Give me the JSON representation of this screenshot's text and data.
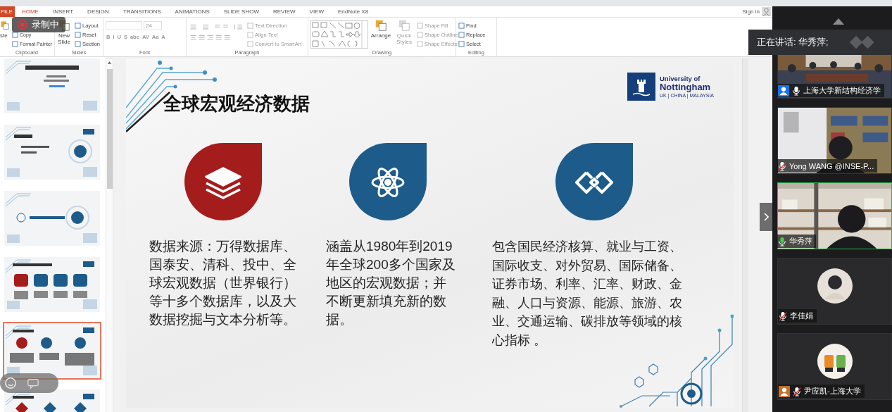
{
  "ribbon_tabs": [
    {
      "label": "FILE",
      "kind": "file",
      "selected": false
    },
    {
      "label": "HOME",
      "kind": "tab",
      "selected": true
    },
    {
      "label": "INSERT",
      "kind": "tab",
      "selected": false
    },
    {
      "label": "DESIGN",
      "kind": "tab",
      "selected": false
    },
    {
      "label": "TRANSITIONS",
      "kind": "tab",
      "selected": false
    },
    {
      "label": "ANIMATIONS",
      "kind": "tab",
      "selected": false
    },
    {
      "label": "SLIDE SHOW",
      "kind": "tab",
      "selected": false
    },
    {
      "label": "REVIEW",
      "kind": "tab",
      "selected": false
    },
    {
      "label": "VIEW",
      "kind": "tab",
      "selected": false
    },
    {
      "label": "EndNote X8",
      "kind": "tab",
      "selected": false
    }
  ],
  "account": {
    "label": "Sign in"
  },
  "ribbon_groups": [
    {
      "label": "Clipboard",
      "columns": [
        {
          "kind": "large",
          "items": [
            {
              "label": "ste",
              "disabled": false
            }
          ]
        },
        {
          "kind": "small",
          "items": [
            {
              "label": "Copy",
              "disabled": false
            },
            {
              "label": "Format Painter",
              "disabled": false
            }
          ]
        }
      ]
    },
    {
      "label": "Slides",
      "columns": [
        {
          "kind": "large",
          "items": [
            {
              "label": "New Slide",
              "disabled": false
            }
          ]
        },
        {
          "kind": "small",
          "items": [
            {
              "label": "Layout",
              "disabled": false
            },
            {
              "label": "Reset",
              "disabled": false
            },
            {
              "label": "Section",
              "disabled": false
            }
          ]
        }
      ]
    },
    {
      "label": "Font",
      "columns": [
        {
          "kind": "font",
          "size": "24",
          "buttons": [
            "B",
            "I",
            "U",
            "S",
            "abc",
            "AV",
            "Aa",
            "A"
          ]
        }
      ]
    },
    {
      "label": "Paragraph",
      "columns": [
        {
          "kind": "tools"
        },
        {
          "kind": "small",
          "items": [
            {
              "label": "Text Direction",
              "disabled": true
            },
            {
              "label": "Align Text",
              "disabled": true
            },
            {
              "label": "Convert to SmartArt",
              "disabled": true
            }
          ]
        }
      ]
    },
    {
      "label": "Drawing",
      "columns": [
        {
          "kind": "gallery"
        },
        {
          "kind": "large",
          "items": [
            {
              "label": "Arrange",
              "disabled": false
            }
          ]
        },
        {
          "kind": "large",
          "items": [
            {
              "label": "Quick Styles",
              "disabled": true
            }
          ]
        },
        {
          "kind": "small",
          "items": [
            {
              "label": "Shape Fill",
              "disabled": true
            },
            {
              "label": "Shape Outline",
              "disabled": true
            },
            {
              "label": "Shape Effects",
              "disabled": true
            }
          ]
        }
      ]
    },
    {
      "label": "Editing",
      "columns": [
        {
          "kind": "small",
          "items": [
            {
              "label": "Find",
              "disabled": false
            },
            {
              "label": "Replace",
              "disabled": false
            },
            {
              "label": "Select",
              "disabled": false
            }
          ]
        }
      ]
    }
  ],
  "recording": {
    "label": "录制中"
  },
  "slides": [
    {
      "kind": "title",
      "selected": false
    },
    {
      "kind": "agenda",
      "selected": false
    },
    {
      "kind": "section",
      "selected": false
    },
    {
      "kind": "cards",
      "selected": false
    },
    {
      "kind": "drops",
      "selected": true
    },
    {
      "kind": "diamonds",
      "selected": false
    }
  ],
  "slide": {
    "title": "全球宏观经济数据",
    "logo": {
      "line_1": "University of",
      "line_2": "Nottingham",
      "line_3": "UK | CHINA | MALAYSIA"
    },
    "columns": [
      {
        "color": "#a51c1c",
        "text": "数据来源：万得数据库、国泰安、清科、投中、全球宏观数据（世界银行）等十多个数据库，以及大数据挖掘与文本分析等。"
      },
      {
        "color": "#1d5b8a",
        "text": "涵盖从1980年到2019年全球200多个国家及地区的宏观数据；并不断更新填充新的数据。"
      },
      {
        "color": "#1d5b8a",
        "text": "包含国民经济核算、就业与工资、国际收支、对外贸易、国际储备、证券市场、利率、汇率、财政、金融、人口与资源、能源、旅游、农业、交通运输、碳排放等领域的核心指标 。"
      }
    ]
  },
  "speaking": {
    "label": "正在讲话: 华秀萍;"
  },
  "participants": [
    {
      "name": "上海大学新结构经济学",
      "kind": "video",
      "muted": false,
      "speaking": false,
      "badge": {
        "color": "#1a73e8"
      }
    },
    {
      "name": "Yong WANG @INSE-P...",
      "kind": "video",
      "muted": true,
      "speaking": false
    },
    {
      "name": "华秀萍",
      "kind": "video",
      "muted": false,
      "speaking": true
    },
    {
      "name": "李佳娟",
      "kind": "avatar",
      "muted": true,
      "speaking": false
    },
    {
      "name": "尹应凯-上海大学",
      "kind": "avatar",
      "muted": true,
      "speaking": false,
      "badge": {
        "color": "#c8702a"
      }
    }
  ]
}
